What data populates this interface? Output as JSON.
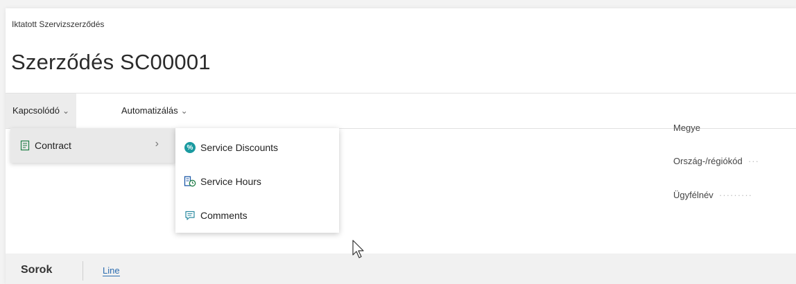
{
  "breadcrumb": "Iktatott Szervizszerződés",
  "page_title": "Szerződés SC00001",
  "actions": {
    "related_label": "Kapcsolódó",
    "automate_label": "Automatizálás"
  },
  "fields": {
    "county_label": "Megye",
    "country_label": "Ország-/régiókód",
    "customer_label": "Ügyfélnév"
  },
  "menu": {
    "contract_label": "Contract",
    "submenu": [
      {
        "label": "Service Discounts",
        "icon": "discount-icon"
      },
      {
        "label": "Service Hours",
        "icon": "service-hours-icon"
      },
      {
        "label": "Comments",
        "icon": "comment-icon"
      }
    ]
  },
  "lines": {
    "title": "Sorok",
    "tab_line": "Line"
  },
  "colors": {
    "accent": "#2b6cb0",
    "discount_icon": "#1a9aa0"
  }
}
